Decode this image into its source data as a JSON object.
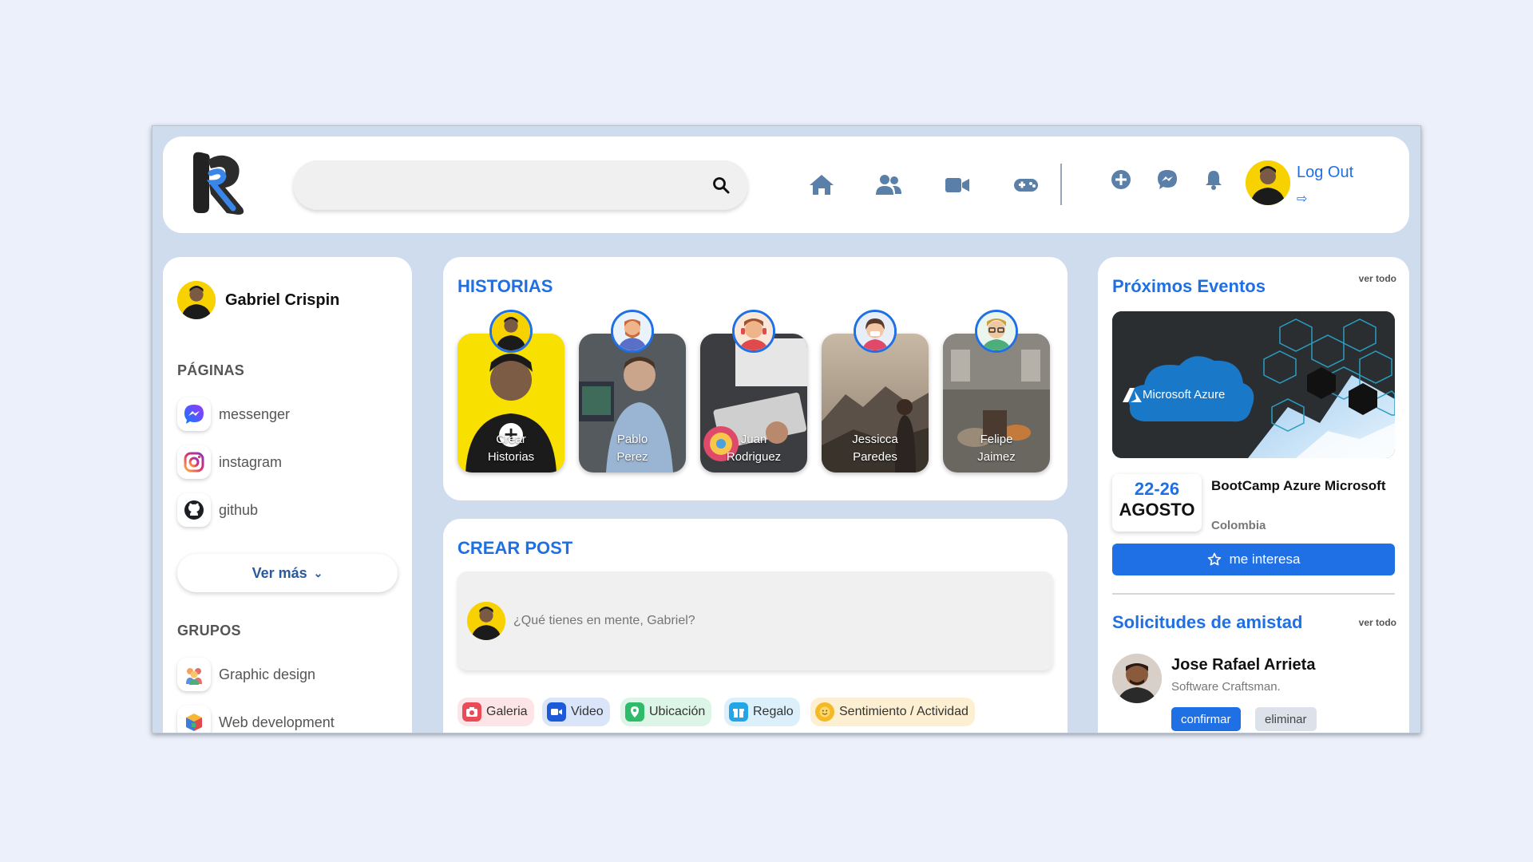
{
  "header": {
    "logo_icon": "r-logo-icon",
    "search": {
      "placeholder": "",
      "icon": "search-icon"
    },
    "nav": [
      {
        "icon": "home-icon"
      },
      {
        "icon": "friends-icon"
      },
      {
        "icon": "video-icon"
      },
      {
        "icon": "gamepad-icon"
      }
    ],
    "actions": [
      {
        "icon": "add-circle-icon"
      },
      {
        "icon": "messenger-icon"
      },
      {
        "icon": "bell-icon"
      }
    ],
    "logout_label": "Log Out",
    "logout_icon": "arrow-right-icon"
  },
  "sidebar": {
    "user_name": "Gabriel Crispin",
    "pages_title": "PÁGINAS",
    "pages": [
      {
        "label": "messenger",
        "icon": "messenger-icon"
      },
      {
        "label": "instagram",
        "icon": "instagram-icon"
      },
      {
        "label": "github",
        "icon": "github-icon"
      }
    ],
    "more_label": "Ver más",
    "groups_title": "GRUPOS",
    "groups": [
      {
        "label": "Graphic design",
        "icon": "group-people-icon"
      },
      {
        "label": "Web development",
        "icon": "cube-icon"
      }
    ]
  },
  "stories": {
    "title": "HISTORIAS",
    "items": [
      {
        "line1": "Crear",
        "line2": "Historias"
      },
      {
        "line1": "Pablo",
        "line2": "Perez"
      },
      {
        "line1": "Juan",
        "line2": "Rodriguez"
      },
      {
        "line1": "Jessicca",
        "line2": "Paredes"
      },
      {
        "line1": "Felipe",
        "line2": "Jaimez"
      }
    ]
  },
  "post": {
    "title": "CREAR POST",
    "placeholder": "¿Qué tienes en mente, Gabriel?",
    "actions": [
      {
        "label": "Galeria",
        "icon": "camera-icon",
        "color": "#e94b57"
      },
      {
        "label": "Video",
        "icon": "video-icon",
        "color": "#1c5ad8"
      },
      {
        "label": "Ubicación",
        "icon": "location-icon",
        "color": "#2fbb6a"
      },
      {
        "label": "Regalo",
        "icon": "gift-icon",
        "color": "#23a6e8"
      },
      {
        "label": "Sentimiento / Actividad",
        "icon": "smile-icon",
        "color": "#f5b928"
      }
    ]
  },
  "events": {
    "title": "Próximos Eventos",
    "see_all": "ver todo",
    "image_text": "Microsoft Azure",
    "date_range": "22-26",
    "date_month": "AGOSTO",
    "name": "BootCamp Azure Microsoft",
    "location": "Colombia",
    "button_label": "me interesa"
  },
  "friend_requests": {
    "title": "Solicitudes de amistad",
    "see_all": "ver todo",
    "name": "Jose Rafael Arrieta",
    "subtitle": "Software Craftsman.",
    "confirm_label": "confirmar",
    "delete_label": "eliminar"
  },
  "colors": {
    "accent": "#1f6fe5",
    "background": "#cedcee",
    "page": "#ebf0fb"
  }
}
